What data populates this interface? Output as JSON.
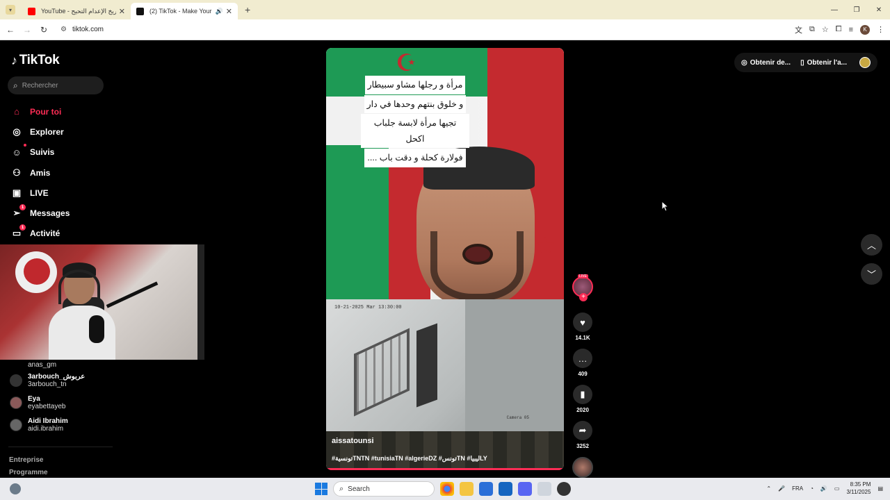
{
  "browser": {
    "tabs": [
      {
        "title": "YouTube - تاريخ الإعدام التحيح",
        "active": false
      },
      {
        "title": "(2) TikTok - Make Your Day",
        "active": true
      }
    ],
    "url": "tiktok.com"
  },
  "tiktok": {
    "logo": "TikTok",
    "search_placeholder": "Rechercher",
    "nav": [
      {
        "label": "Pour toi",
        "icon": "home-icon",
        "active": true
      },
      {
        "label": "Explorer",
        "icon": "compass-icon"
      },
      {
        "label": "Suivis",
        "icon": "following-icon"
      },
      {
        "label": "Amis",
        "icon": "friends-icon"
      },
      {
        "label": "LIVE",
        "icon": "live-icon"
      },
      {
        "label": "Messages",
        "icon": "messages-icon",
        "badge": "1"
      },
      {
        "label": "Activité",
        "icon": "activity-icon",
        "badge": "1"
      }
    ],
    "following": [
      {
        "display": "anas_gm",
        "handle": ""
      },
      {
        "display": "3arbouch_عربوش",
        "handle": "3arbouch_tn"
      },
      {
        "display": "Eya",
        "handle": "eyabettayeb"
      },
      {
        "display": "Aidi Ibrahim",
        "handle": "aidi.ibrahim"
      }
    ],
    "footer": [
      "Entreprise",
      "Programme"
    ],
    "top_buttons": [
      "Obtenir de...",
      "Obtenir l'a..."
    ]
  },
  "video": {
    "caption_lines": [
      "مرأة و رجلها مشاو سبيطار",
      "و خلوق بنتهم وحدها في دار",
      "تجيها مرأة لابسة جلباب اكحل",
      "فولارة كحلة و دقت باب ...."
    ],
    "cam_timestamp": "10-21-2025 Mar  13:30:00",
    "cam_label": "Camera 05",
    "username": "aissatounsi",
    "hashtags": "#تونسيةTNTN #tunisiaTN #algerieDZ #تونسTN #ليبياLY",
    "likes": "14.1K",
    "comments": "409",
    "saves": "2020",
    "shares": "3252",
    "live_label": "LIVE"
  },
  "taskbar": {
    "search": "Search",
    "lang": "FRA",
    "time": "8:35 PM",
    "date": "3/11/2025"
  }
}
